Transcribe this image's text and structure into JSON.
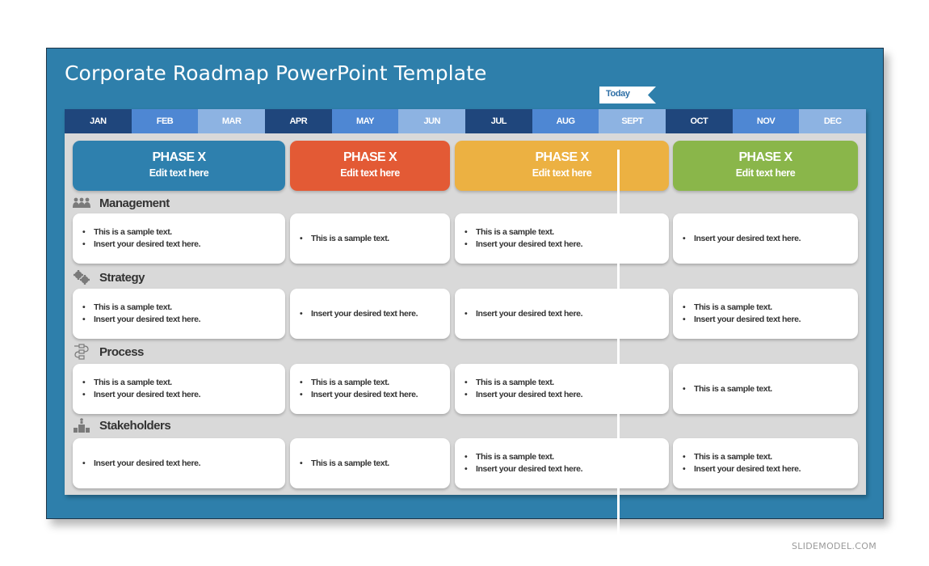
{
  "slide": {
    "title": "Corporate Roadmap PowerPoint Template"
  },
  "months": [
    "JAN",
    "FEB",
    "MAR",
    "APR",
    "MAY",
    "JUN",
    "JUL",
    "AUG",
    "SEPT",
    "OCT",
    "NOV",
    "DEC"
  ],
  "today_marker": {
    "label": "Today",
    "month": "SEPT"
  },
  "phases": [
    {
      "title": "PHASE X",
      "subtitle": "Edit text here",
      "color": "#2e80ae"
    },
    {
      "title": "PHASE X",
      "subtitle": "Edit text here",
      "color": "#e35a35"
    },
    {
      "title": "PHASE X",
      "subtitle": "Edit text here",
      "color": "#ecb142"
    },
    {
      "title": "PHASE X",
      "subtitle": "Edit text here",
      "color": "#8ab64a"
    }
  ],
  "categories": [
    {
      "label": "Management",
      "icon": "people-icon",
      "cells": [
        [
          "This is a sample text.",
          "Insert your desired text here."
        ],
        [
          "This is a sample text."
        ],
        [
          "This is a sample text.",
          "Insert your desired text here."
        ],
        [
          "Insert your desired text here."
        ]
      ]
    },
    {
      "label": "Strategy",
      "icon": "gears-icon",
      "cells": [
        [
          "This is a sample text.",
          "Insert your desired text here."
        ],
        [
          "Insert your desired text here."
        ],
        [
          "Insert your desired text here."
        ],
        [
          "This is a sample text.",
          "Insert your desired text here."
        ]
      ]
    },
    {
      "label": "Process",
      "icon": "flowchart-icon",
      "cells": [
        [
          "This is a sample text.",
          "Insert your desired text here."
        ],
        [
          "This is a sample text.",
          "Insert your desired text here."
        ],
        [
          "This is a sample text.",
          "Insert your desired text here."
        ],
        [
          "This is a sample text."
        ]
      ]
    },
    {
      "label": "Stakeholders",
      "icon": "podium-icon",
      "cells": [
        [
          "Insert your desired text here."
        ],
        [
          "This is a sample text."
        ],
        [
          "This is a sample text.",
          "Insert your desired text here."
        ],
        [
          "This is a sample text.",
          "Insert your desired text here."
        ]
      ]
    }
  ],
  "watermark": "SLIDEMODEL.COM"
}
